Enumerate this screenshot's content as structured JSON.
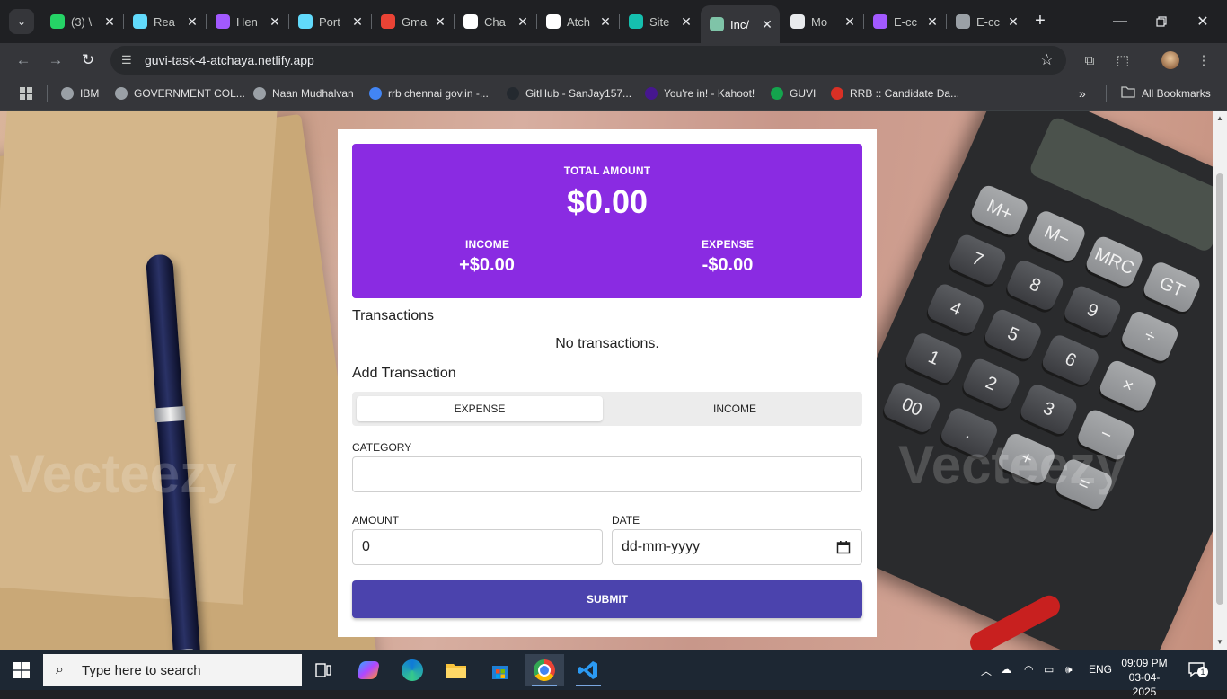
{
  "browser": {
    "tabs": [
      {
        "title": "(3) \\",
        "icon": "whatsapp-icon",
        "color": "#25d366"
      },
      {
        "title": "Rea",
        "icon": "react-icon",
        "color": "#61dafb"
      },
      {
        "title": "Hen",
        "icon": "vite-icon",
        "color": "#a259ff"
      },
      {
        "title": "Port",
        "icon": "react-icon",
        "color": "#61dafb"
      },
      {
        "title": "Gma",
        "icon": "gmail-icon",
        "color": "#ea4335"
      },
      {
        "title": "Cha",
        "icon": "chatgpt-icon",
        "color": "#ffffff"
      },
      {
        "title": "Atch",
        "icon": "github-icon",
        "color": "#ffffff"
      },
      {
        "title": "Site",
        "icon": "netlify-icon",
        "color": "#15bfae"
      },
      {
        "title": "Inc/",
        "icon": "calculator-icon",
        "color": "#7fc4a8"
      },
      {
        "title": "Mo",
        "icon": "page-icon",
        "color": "#e8eaed"
      },
      {
        "title": "E-cc",
        "icon": "vite-icon",
        "color": "#a259ff"
      },
      {
        "title": "E-cc",
        "icon": "globe-icon",
        "color": "#9aa0a6"
      }
    ],
    "active_tab_index": 8,
    "url": "guvi-task-4-atchaya.netlify.app",
    "bookmarks": [
      {
        "label": "IBM",
        "icon": "globe-icon",
        "color": "#9aa0a6"
      },
      {
        "label": "GOVERNMENT COL...",
        "icon": "globe-icon",
        "color": "#9aa0a6"
      },
      {
        "label": "Naan Mudhalvan",
        "icon": "globe-icon",
        "color": "#9aa0a6"
      },
      {
        "label": "rrb chennai gov.in -...",
        "icon": "google-icon",
        "color": "#4285f4"
      },
      {
        "label": "GitHub - SanJay157...",
        "icon": "github-icon",
        "color": "#24292f"
      },
      {
        "label": "You're in! - Kahoot!",
        "icon": "kahoot-icon",
        "color": "#46178f"
      },
      {
        "label": "GUVI",
        "icon": "guvi-icon",
        "color": "#14a44d"
      },
      {
        "label": "RRB :: Candidate Da...",
        "icon": "rrb-icon",
        "color": "#d93025"
      }
    ],
    "all_bookmarks": "All Bookmarks"
  },
  "app": {
    "summary": {
      "total_label": "TOTAL AMOUNT",
      "total_value": "$0.00",
      "income_label": "INCOME",
      "income_value": "+$0.00",
      "expense_label": "EXPENSE",
      "expense_value": "-$0.00"
    },
    "transactions_title": "Transactions",
    "empty_text": "No transactions.",
    "add_title": "Add Transaction",
    "type_toggle": {
      "expense": "EXPENSE",
      "income": "INCOME",
      "selected": "EXPENSE"
    },
    "category_label": "CATEGORY",
    "category_value": "",
    "amount_label": "AMOUNT",
    "amount_value": "0",
    "date_label": "DATE",
    "date_placeholder": "dd-mm-yyyy",
    "submit_label": "SUBMIT",
    "colors": {
      "summary_bg": "#8a2be2",
      "submit_bg": "#4b43ad"
    }
  },
  "taskbar": {
    "search_placeholder": "Type here to search",
    "language": "ENG",
    "time": "09:09 PM",
    "date": "03-04-2025",
    "notification_count": "1"
  }
}
